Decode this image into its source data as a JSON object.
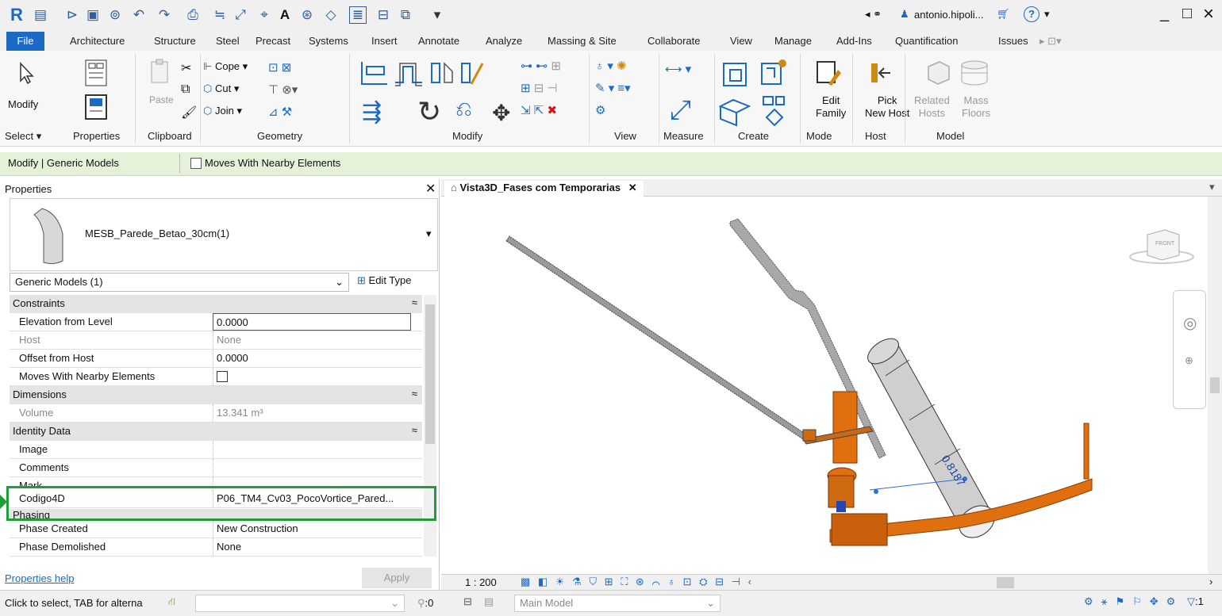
{
  "title_bar": {
    "user_name": "antonio.hipoli...",
    "help_label": "?",
    "window_controls": [
      "_",
      "□",
      "×"
    ]
  },
  "menu": {
    "file": "File",
    "tabs": [
      "Architecture",
      "Structure",
      "Steel",
      "Precast",
      "Systems",
      "Insert",
      "Annotate",
      "Analyze",
      "Massing & Site",
      "Collaborate",
      "View",
      "Manage",
      "Add-Ins",
      "Quantification",
      "Issues"
    ]
  },
  "ribbon": {
    "modify": "Modify",
    "paste": "Paste",
    "cope": "Cope",
    "cut": "Cut",
    "join": "Join",
    "edit_family": "Edit\nFamily",
    "edit_family_l1": "Edit",
    "edit_family_l2": "Family",
    "pick_new_host_l1": "Pick",
    "pick_new_host_l2": "New Host",
    "related_hosts_l1": "Related",
    "related_hosts_l2": "Hosts",
    "mass_floors_l1": "Mass",
    "mass_floors_l2": "Floors",
    "panels": [
      "Select ▾",
      "Properties",
      "Clipboard",
      "Geometry",
      "Modify",
      "View",
      "Measure",
      "Create",
      "Mode",
      "Host",
      "Model"
    ]
  },
  "context_bar": {
    "label": "Modify | Generic Models",
    "checkbox_label": "Moves With Nearby Elements"
  },
  "properties": {
    "header": "Properties",
    "type_name": "MESB_Parede_Betao_30cm(1)",
    "category_select": "Generic Models (1)",
    "edit_type": "Edit Type",
    "sections": {
      "constraints": "Constraints",
      "dimensions": "Dimensions",
      "identity": "Identity Data",
      "phasing": "Phasing"
    },
    "rows": {
      "elevation_k": "Elevation from Level",
      "elevation_v": "0.0000",
      "host_k": "Host",
      "host_v": "None",
      "offset_k": "Offset from Host",
      "offset_v": "0.0000",
      "moves_k": "Moves With Nearby Elements",
      "volume_k": "Volume",
      "volume_v": "13.341 m³",
      "image_k": "Image",
      "comments_k": "Comments",
      "mark_k": "Mark",
      "codigo_k": "Codigo4D",
      "codigo_v": "P06_TM4_Cv03_PocoVortice_Pared...",
      "phase_created_k": "Phase Created",
      "phase_created_v": "New Construction",
      "phase_demolished_k": "Phase Demolished",
      "phase_demolished_v": "None"
    },
    "help_link": "Properties help",
    "apply": "Apply"
  },
  "view": {
    "tab_title": "Vista3D_Fases com Temporarias",
    "viewcube_face": "FRONT",
    "dimension_value": "0.8187",
    "scale": "1 : 200"
  },
  "status_bar": {
    "hint": "Click to select, TAB for alterna",
    "worksets_count": ":0",
    "model": "Main Model",
    "filter_count": ":1"
  },
  "colors": {
    "accent": "#1b6ac5",
    "context_bar": "#e6f1d9",
    "highlight_box": "#1f9d3a",
    "pipe_orange": "#e0700f"
  }
}
